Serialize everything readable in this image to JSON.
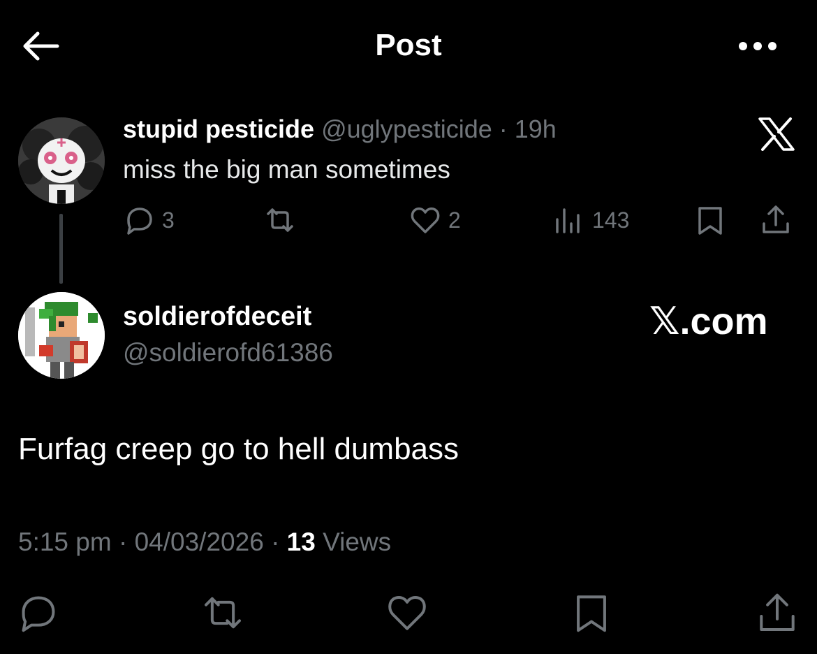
{
  "header": {
    "title": "Post",
    "back_icon": "arrow-left-icon",
    "more_icon": "more-horizontal-icon"
  },
  "parent_post": {
    "display_name": "stupid pesticide",
    "handle": "@uglypesticide",
    "separator": "·",
    "time": "19h",
    "text": "miss the big man sometimes",
    "actions": {
      "replies": "3",
      "reposts": "",
      "likes": "2",
      "views": "143"
    }
  },
  "reply_post": {
    "display_name": "soldierofdeceit",
    "handle": "@soldierofd61386",
    "watermark": "𝕏.com",
    "text": "Furfag creep go to hell dumbass",
    "time": "5:15 pm",
    "sep1": "·",
    "date": "04/03/2026",
    "sep2": "·",
    "views_count": "13",
    "views_label": "Views"
  },
  "colors": {
    "background": "#000000",
    "text": "#e7e9ea",
    "muted": "#71767b",
    "thread_line": "#3b3f43"
  }
}
